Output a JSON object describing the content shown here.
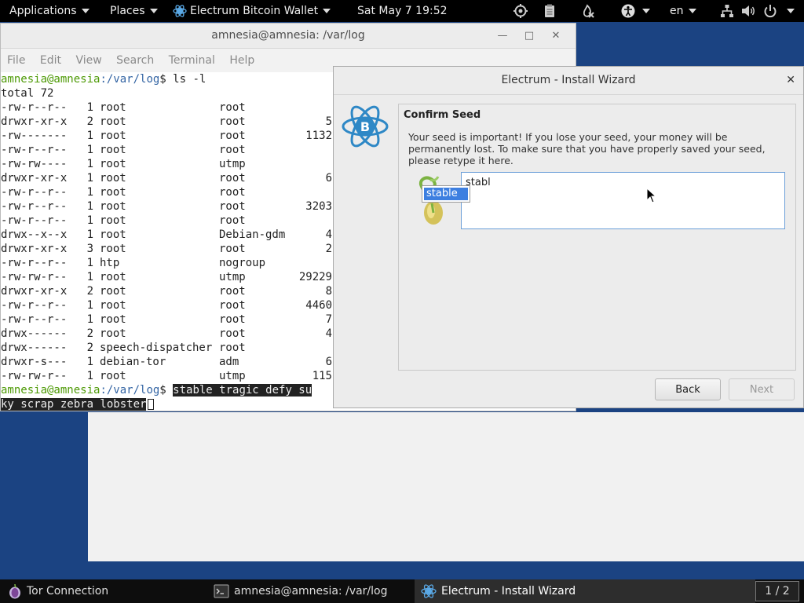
{
  "topbar": {
    "applications": "Applications",
    "places": "Places",
    "app_name": "Electrum Bitcoin Wallet",
    "clock": "Sat May 7  19:52",
    "lang": "en"
  },
  "terminal": {
    "title": "amnesia@amnesia: /var/log",
    "menu": [
      "File",
      "Edit",
      "View",
      "Search",
      "Terminal",
      "Help"
    ],
    "prompt_user": "amnesia@amnesia",
    "prompt_path": ":/var/log",
    "prompt_symbol": "$ ",
    "command": "ls -l",
    "total": "total 72",
    "rows": [
      {
        "perm": "-rw-r--r--",
        "n": "1",
        "owner": "root",
        "group": "root",
        "size": ""
      },
      {
        "perm": "drwxr-xr-x",
        "n": "2",
        "owner": "root",
        "group": "root",
        "size": "5"
      },
      {
        "perm": "-rw-------",
        "n": "1",
        "owner": "root",
        "group": "root",
        "size": "1132"
      },
      {
        "perm": "-rw-r--r--",
        "n": "1",
        "owner": "root",
        "group": "root",
        "size": ""
      },
      {
        "perm": "-rw-rw----",
        "n": "1",
        "owner": "root",
        "group": "utmp",
        "size": ""
      },
      {
        "perm": "drwxr-xr-x",
        "n": "1",
        "owner": "root",
        "group": "root",
        "size": "6"
      },
      {
        "perm": "-rw-r--r--",
        "n": "1",
        "owner": "root",
        "group": "root",
        "size": ""
      },
      {
        "perm": "-rw-r--r--",
        "n": "1",
        "owner": "root",
        "group": "root",
        "size": "3203"
      },
      {
        "perm": "-rw-r--r--",
        "n": "1",
        "owner": "root",
        "group": "root",
        "size": ""
      },
      {
        "perm": "drwx--x--x",
        "n": "1",
        "owner": "root",
        "group": "Debian-gdm",
        "size": "4"
      },
      {
        "perm": "drwxr-xr-x",
        "n": "3",
        "owner": "root",
        "group": "root",
        "size": "2"
      },
      {
        "perm": "-rw-r--r--",
        "n": "1",
        "owner": "htp",
        "group": "nogroup",
        "size": ""
      },
      {
        "perm": "-rw-rw-r--",
        "n": "1",
        "owner": "root",
        "group": "utmp",
        "size": "29229"
      },
      {
        "perm": "drwxr-xr-x",
        "n": "2",
        "owner": "root",
        "group": "root",
        "size": "8"
      },
      {
        "perm": "-rw-r--r--",
        "n": "1",
        "owner": "root",
        "group": "root",
        "size": "4460"
      },
      {
        "perm": "-rw-r--r--",
        "n": "1",
        "owner": "root",
        "group": "root",
        "size": "7"
      },
      {
        "perm": "drwx------",
        "n": "2",
        "owner": "root",
        "group": "root",
        "size": "4"
      },
      {
        "perm": "drwx------",
        "n": "2",
        "owner": "speech-dispatcher",
        "group": "root",
        "size": ""
      },
      {
        "perm": "drwxr-s---",
        "n": "1",
        "owner": "debian-tor",
        "group": "adm",
        "size": "6"
      },
      {
        "perm": "-rw-rw-r--",
        "n": "1",
        "owner": "root",
        "group": "utmp",
        "size": "115"
      }
    ],
    "typed_1": "stable tragic defy su",
    "typed_2": "ky scrap zebra lobster"
  },
  "wizard": {
    "title": "Electrum  -  Install Wizard",
    "close": "✕",
    "heading": "Confirm Seed",
    "message": "Your seed is important! If you lose your seed, your money will be permanently lost. To make sure that you have properly saved your seed, please retype it here.",
    "input_value": "stabl",
    "suggestion": "stable",
    "back": "Back",
    "next": "Next"
  },
  "taskbar": {
    "tor": "Tor Connection",
    "terminal": "amnesia@amnesia: /var/log",
    "electrum": "Electrum  -  Install Wizard",
    "workspace": "1 / 2"
  },
  "colors": {
    "desktop": "#1b4382",
    "prompt_green": "#4e9a06",
    "prompt_blue": "#3465a4",
    "electrum_blue": "#2e88c6",
    "selection": "#3d7fe0"
  }
}
